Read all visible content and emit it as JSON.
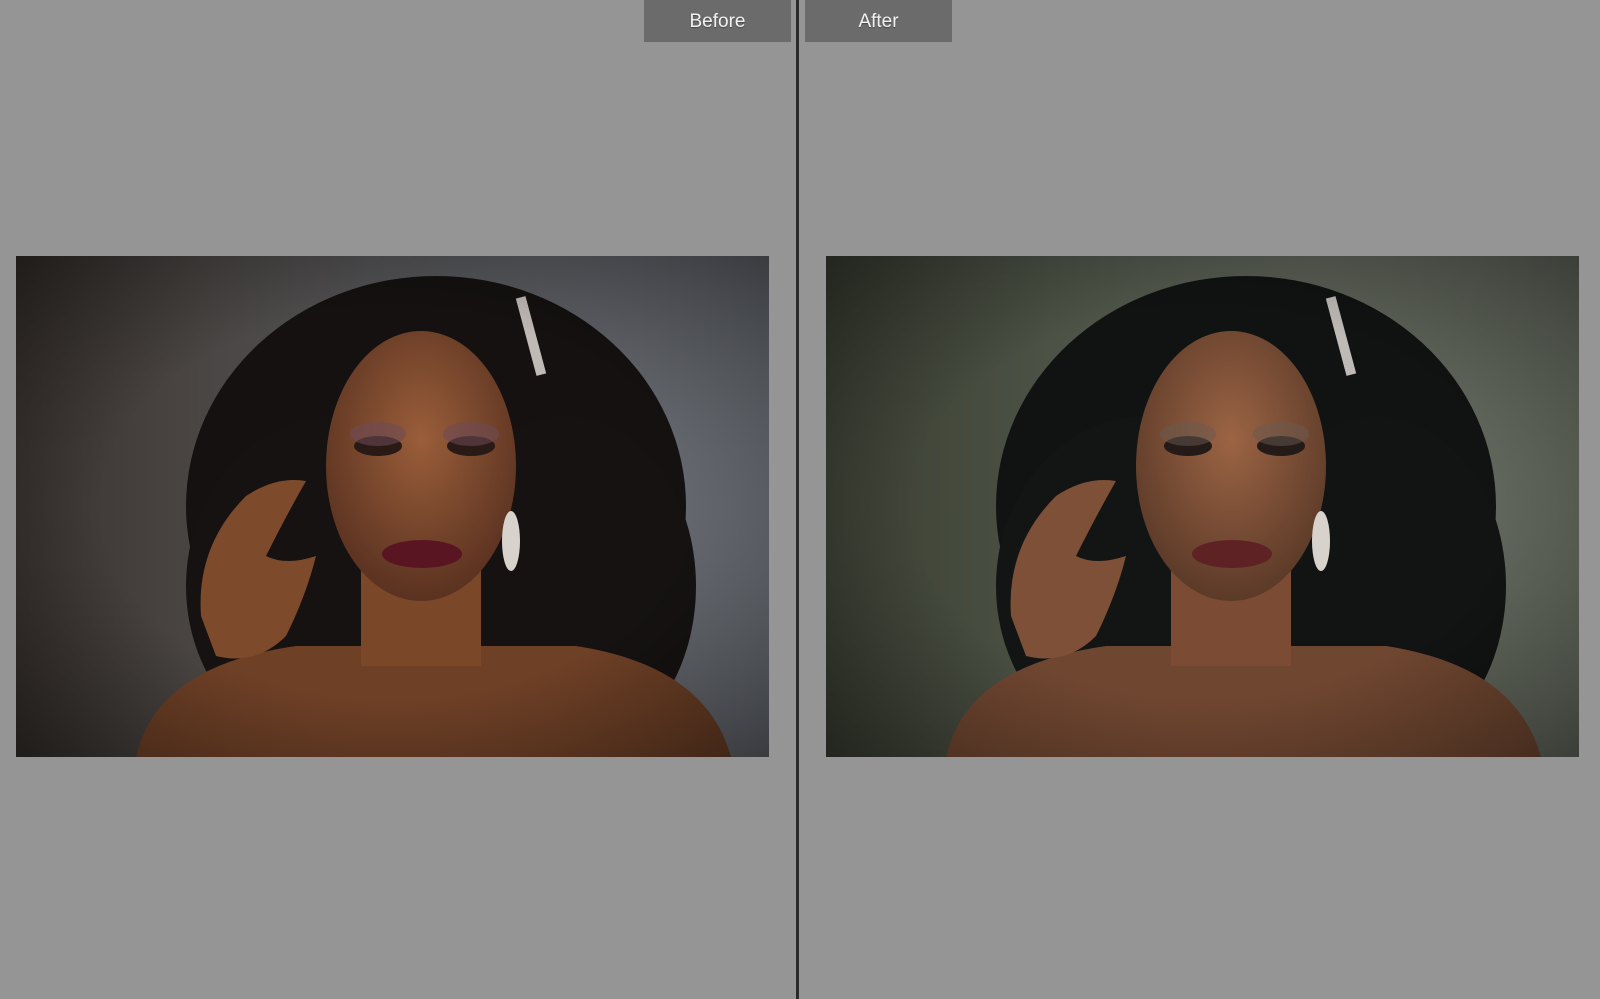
{
  "compare": {
    "before_label": "Before",
    "after_label": "After"
  },
  "colors": {
    "background": "#959595",
    "tab": "#6b6b6b",
    "divider": "#2a2a2a"
  }
}
